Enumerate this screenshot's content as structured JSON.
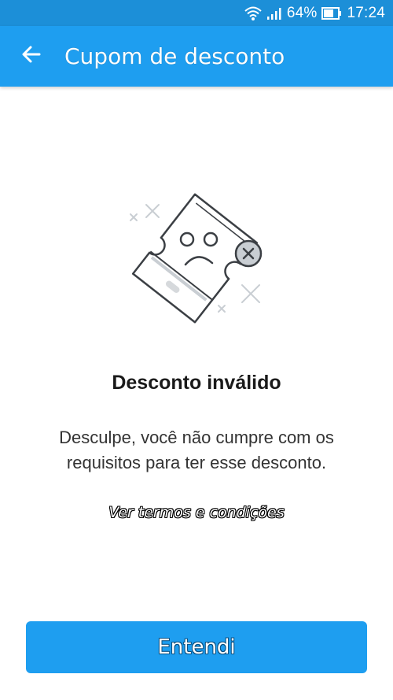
{
  "status_bar": {
    "battery_percent": "64%",
    "time": "17:24",
    "icons": [
      "wifi-icon",
      "signal-icon",
      "battery-icon"
    ]
  },
  "app_bar": {
    "title": "Cupom de desconto",
    "back_icon": "arrow-left-icon"
  },
  "content": {
    "illustration": "broken-coupon-sad-face",
    "headline": "Desconto inválido",
    "message": "Desculpe, você não cumpre com os requisitos para ter esse desconto.",
    "terms_link": "Ver termos e condições"
  },
  "actions": {
    "confirm_label": "Entendi"
  },
  "colors": {
    "status_bar": "#1c8fd8",
    "primary": "#1e9ef0",
    "text_dark": "#1a1a1a"
  }
}
